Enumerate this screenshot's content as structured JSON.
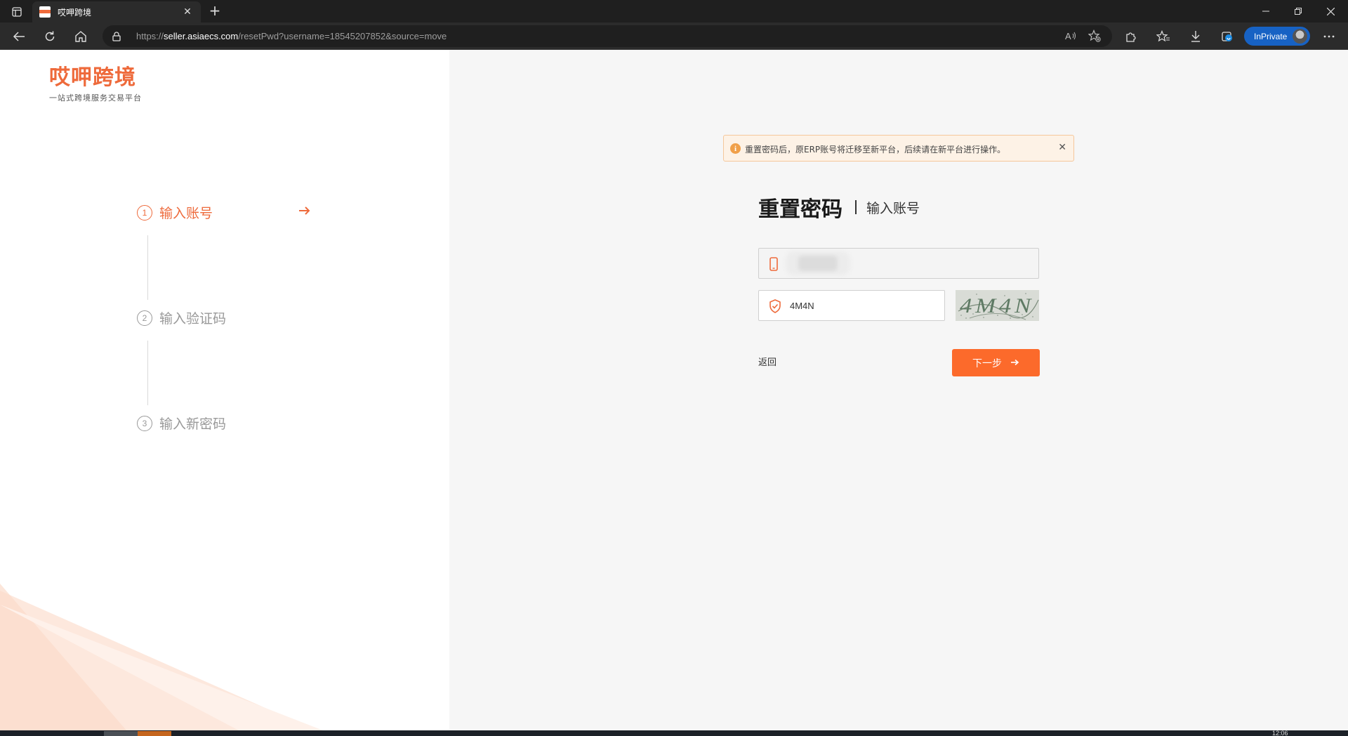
{
  "browser": {
    "tab_title": "哎呷跨境",
    "url_scheme": "https://",
    "url_host": "seller.asiaecs.com",
    "url_path": "/resetPwd?username=18545207852&source=move",
    "inprivate_label": "InPrivate",
    "accent_color": "#1762c4"
  },
  "brand": {
    "name": "哎呷跨境",
    "slogan": "一站式跨境服务交易平台",
    "color": "#ee6a3b"
  },
  "steps": [
    {
      "num": "1",
      "label": "输入账号",
      "active": true
    },
    {
      "num": "2",
      "label": "输入验证码",
      "active": false
    },
    {
      "num": "3",
      "label": "输入新密码",
      "active": false
    }
  ],
  "alert": {
    "text": "重置密码后，原ERP账号将迁移至新平台，后续请在新平台进行操作。"
  },
  "form": {
    "title": "重置密码",
    "subtitle": "输入账号",
    "code_value": "4M4N",
    "captcha_text": "4M4N",
    "back_label": "返回",
    "next_label": "下一步",
    "button_color": "#fc6a2b"
  },
  "taskbar": {
    "clock": "12:06"
  }
}
